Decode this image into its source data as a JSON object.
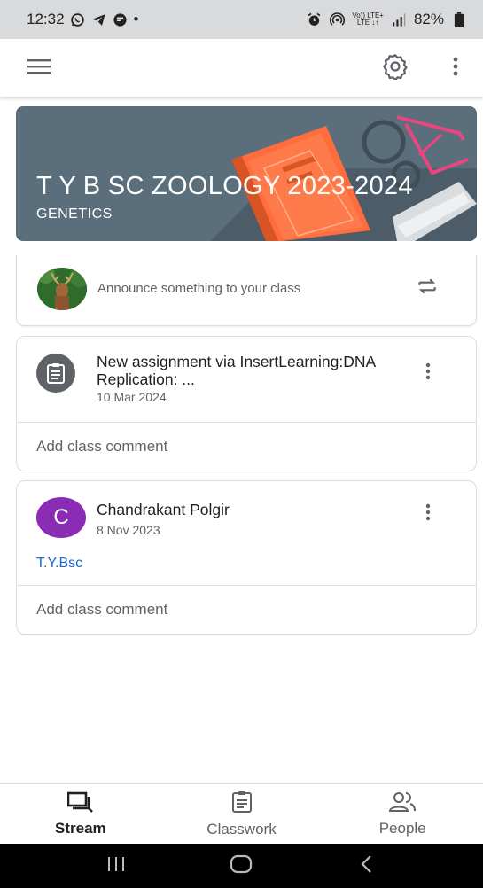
{
  "status_bar": {
    "time": "12:32",
    "dot": "•",
    "battery": "82%",
    "network_top": "Vo)) LTE+",
    "network_bottom": "LTE ↓↑",
    "icons": [
      "whatsapp-icon",
      "telegram-icon",
      "chat-icon",
      "alarm-icon",
      "hotspot-icon",
      "signal-icon",
      "battery-icon"
    ]
  },
  "app_bar": {
    "icons": [
      "menu-icon",
      "settings-icon",
      "more-vert-icon"
    ]
  },
  "banner": {
    "title": "T Y B SC ZOOLOGY 2023-2024",
    "subtitle": "GENETICS",
    "background": "#5b6e7b"
  },
  "announce": {
    "placeholder": "Announce something to your class"
  },
  "posts": [
    {
      "type": "assignment",
      "title": "New assignment via InsertLearning:DNA Replication: ...",
      "date": "10 Mar 2024",
      "comment_label": "Add class comment"
    },
    {
      "type": "announcement",
      "author": "Chandrakant Polgir",
      "avatar_initial": "C",
      "avatar_color": "#8a2db4",
      "date": "8 Nov 2023",
      "body": "T.Y.Bsc",
      "comment_label": "Add class comment"
    }
  ],
  "bottom_nav": {
    "items": [
      {
        "label": "Stream",
        "icon": "stream-icon",
        "active": true
      },
      {
        "label": "Classwork",
        "icon": "classwork-icon",
        "active": false
      },
      {
        "label": "People",
        "icon": "people-icon",
        "active": false
      }
    ]
  },
  "colors": {
    "accent": "#1967d2",
    "banner": "#5b6e7b",
    "avatar": "#8a2db4"
  }
}
